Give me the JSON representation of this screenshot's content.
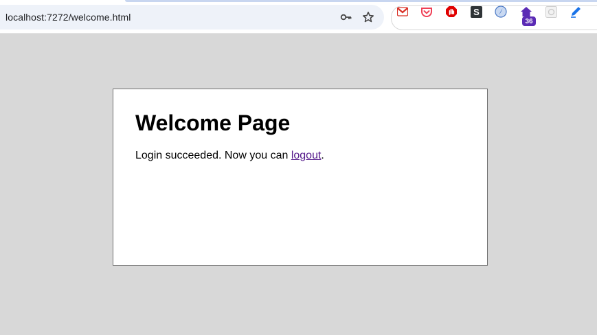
{
  "browser": {
    "url": "localhost:7272/welcome.html",
    "omnibox_icons": [
      "key-icon",
      "star-icon"
    ],
    "extensions": [
      {
        "name": "gmail-icon",
        "color": "#d93025"
      },
      {
        "name": "pocket-icon",
        "color": "#ef4056"
      },
      {
        "name": "adblock-icon",
        "color": "#e00000"
      },
      {
        "name": "s-icon",
        "color": "#2f3437"
      },
      {
        "name": "compass-icon",
        "color": "#4a78c4"
      },
      {
        "name": "house-icon",
        "color": "#5b2bb5"
      },
      {
        "name": "puzzle-icon",
        "color": "#c8c8c8"
      },
      {
        "name": "pen-icon",
        "color": "#1a73e8"
      }
    ],
    "extension_badge": "36"
  },
  "page": {
    "title": "Welcome Page",
    "message_prefix": "Login succeeded. Now you can ",
    "link_label": "logout",
    "message_suffix": ".",
    "link_color": "#551a8b"
  }
}
